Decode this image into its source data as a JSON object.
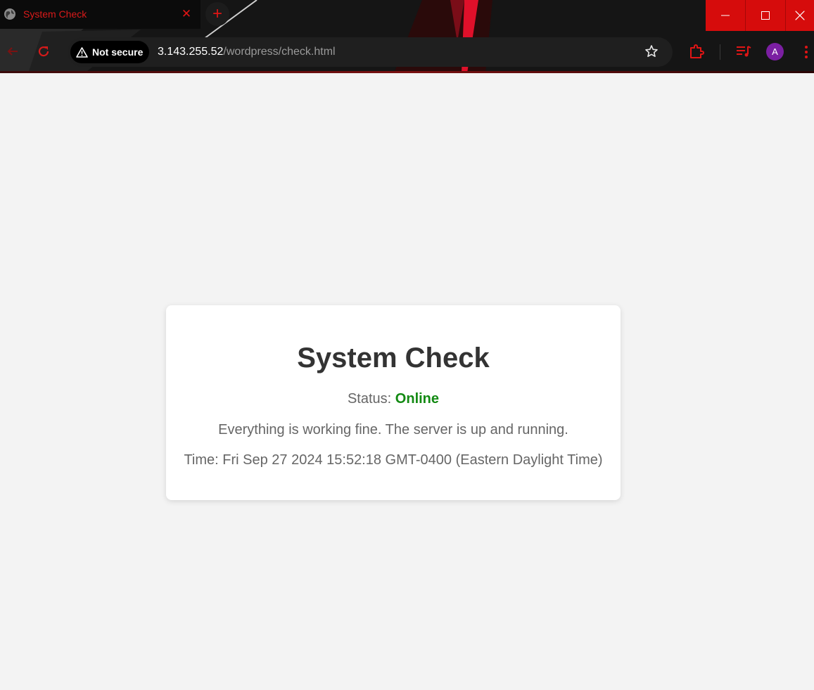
{
  "browser": {
    "tab_title": "System Check",
    "security_label": "Not secure",
    "url_host": "3.143.255.52",
    "url_path": "/wordpress/check.html",
    "profile_initial": "A",
    "accent_color": "#d60c0c"
  },
  "page": {
    "title": "System Check",
    "status_label": "Status:",
    "status_value": "Online",
    "status_color": "#138a13",
    "message": "Everything is working fine. The server is up and running.",
    "time_label": "Time:",
    "time_value": "Fri Sep 27 2024 15:52:18 GMT-0400 (Eastern Daylight Time)"
  },
  "icons": [
    "globe-icon",
    "close-icon",
    "plus-icon",
    "minimize-icon",
    "maximize-icon",
    "window-close-icon",
    "back-arrow-icon",
    "reload-icon",
    "warning-icon",
    "star-icon",
    "extensions-icon",
    "media-controls-icon",
    "kebab-menu-icon"
  ]
}
